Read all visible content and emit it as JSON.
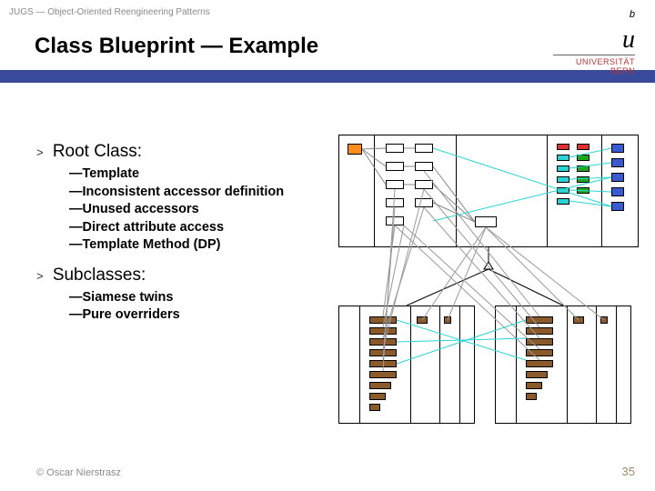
{
  "header": {
    "small": "JUGS — Object-Oriented Reengineering Patterns"
  },
  "title": "Class Blueprint — Example",
  "logo": {
    "sup": "b",
    "main": "u",
    "line1": "UNIVERSITÄT",
    "line2": "BERN"
  },
  "content": {
    "root": {
      "head": "Root Class:",
      "items": [
        "—Template",
        "—Inconsistent accessor definition",
        "—Unused accessors",
        "—Direct attribute access",
        "—Template Method (DP)"
      ]
    },
    "sub": {
      "head": "Subclasses:",
      "items": [
        "—Siamese twins",
        "—Pure overriders"
      ]
    }
  },
  "footer": {
    "left": "© Oscar Nierstrasz",
    "right": "35"
  }
}
